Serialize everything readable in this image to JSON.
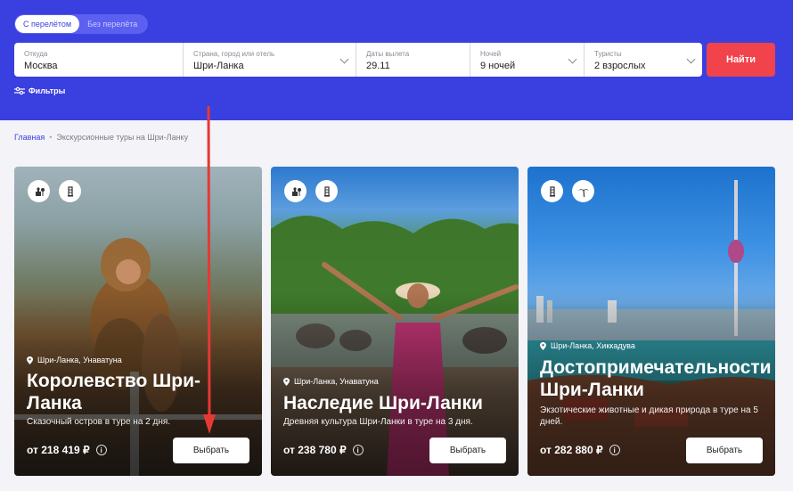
{
  "search": {
    "toggle": {
      "with_flight": "С перелётом",
      "without_flight": "Без перелёта"
    },
    "fields": [
      {
        "label": "Откуда",
        "value": "Москва"
      },
      {
        "label": "Страна, город или отель",
        "value": "Шри-Ланка"
      },
      {
        "label": "Даты вылета",
        "value": "29.11"
      },
      {
        "label": "Ночей",
        "value": "9 ночей"
      },
      {
        "label": "Туристы",
        "value": "2 взрослых"
      }
    ],
    "find_label": "Найти",
    "filters_label": "Фильтры"
  },
  "breadcrumb": {
    "home": "Главная",
    "current": "Экскурсионные туры на Шри-Ланку"
  },
  "cards": [
    {
      "location": "Шри-Ланка, Унаватуна",
      "title": "Королевство Шри-Ланка",
      "description": "Сказочный остров в туре на 2 дня.",
      "price": "от 218 419 ₽",
      "button": "Выбрать",
      "icons": [
        "monument-tree-icon",
        "tower-icon"
      ]
    },
    {
      "location": "Шри-Ланка, Унаватуна",
      "title": "Наследие Шри-Ланки",
      "description": "Древняя культура Шри-Ланки в туре на 3 дня.",
      "price": "от 238 780 ₽",
      "button": "Выбрать",
      "icons": [
        "monument-tree-icon",
        "tower-icon"
      ]
    },
    {
      "location": "Шри-Ланка, Хиккадува",
      "title": "Достопримечательности Шри-Ланки",
      "description": "Экзотические животные и дикая природа в туре на 5 дней.",
      "price": "от 282 880 ₽",
      "button": "Выбрать",
      "icons": [
        "tower-icon",
        "palm-icon"
      ]
    }
  ],
  "info_glyph": "i",
  "colors": {
    "brand_blue": "#3a3fe0",
    "find_red": "#f0434c",
    "annotation_red": "#e53935"
  }
}
